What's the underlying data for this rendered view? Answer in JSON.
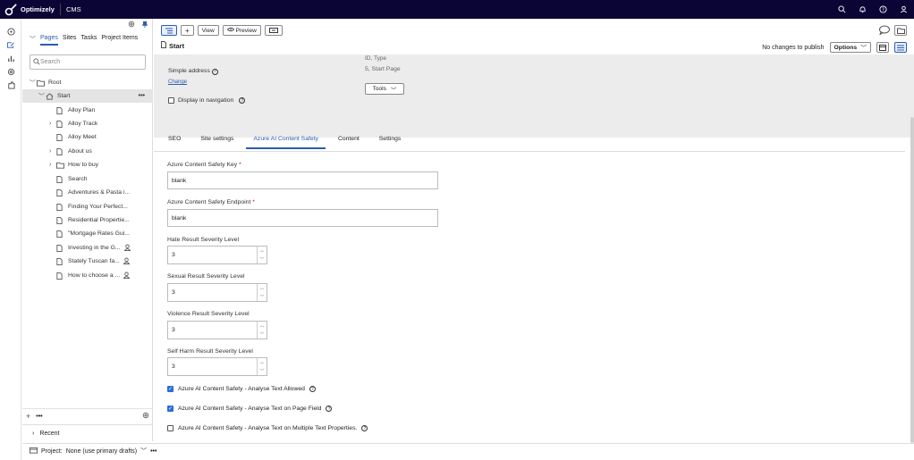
{
  "topbar": {
    "brand": "Optimizely",
    "app": "CMS"
  },
  "tree": {
    "tabs": [
      "Pages",
      "Sites",
      "Tasks",
      "Project Items"
    ],
    "search_placeholder": "Search",
    "nodes": [
      {
        "label": "Root"
      },
      {
        "label": "Start"
      },
      {
        "label": "Alloy Plan"
      },
      {
        "label": "Alloy Track"
      },
      {
        "label": "Alloy Meet"
      },
      {
        "label": "About us"
      },
      {
        "label": "How to buy"
      },
      {
        "label": "Search"
      },
      {
        "label": "Adventures & Pasta i..."
      },
      {
        "label": "Finding Your Perfect..."
      },
      {
        "label": "Residential Propertie..."
      },
      {
        "label": "\"Mortgage Rates Gui..."
      },
      {
        "label": "Investing in the G..."
      },
      {
        "label": "Stately Tuscan fa..."
      },
      {
        "label": "How to choose a ..."
      }
    ],
    "more": "•••",
    "recent": "Recent"
  },
  "project": {
    "label": "Project:",
    "value": "None (use primary drafts)",
    "more": "•••"
  },
  "toolbar": {
    "view": "View",
    "preview": "Preview"
  },
  "page": {
    "title": "Start",
    "publish_status": "No changes to publish",
    "options": "Options"
  },
  "settings": {
    "simple_address": "Simple address",
    "change": "Change",
    "id_type_label": "ID, Type",
    "id_type_value": "5, Start Page",
    "tools": "Tools",
    "display_in_nav": "Display in navigation"
  },
  "form_tabs": [
    "SEO",
    "Site settings",
    "Azure AI Content Safety",
    "Content",
    "Settings"
  ],
  "form": {
    "key_label": "Azure Content Safety Key",
    "key_value": "blank",
    "endpoint_label": "Azure Content Safety Endpoint",
    "endpoint_value": "blank",
    "hate_label": "Hate Result Severity Level",
    "hate_value": "3",
    "sexual_label": "Sexual Result Severity Level",
    "sexual_value": "3",
    "violence_label": "Violence Result Severity Level",
    "violence_value": "3",
    "selfharm_label": "Self Harm Result Severity Level",
    "selfharm_value": "3",
    "cb1": "Azure AI Content Safety - Analyse Text Allowed",
    "cb2": "Azure AI Content Safety - Analyse Text on Page Field",
    "cb3": "Azure AI Content Safety - Analyse Text on Multiple Text Properties."
  },
  "colors": {
    "topbar": "#0b0536",
    "accent": "#2a5db0",
    "checkbox": "#2a6dd6",
    "required": "#cc0000"
  }
}
